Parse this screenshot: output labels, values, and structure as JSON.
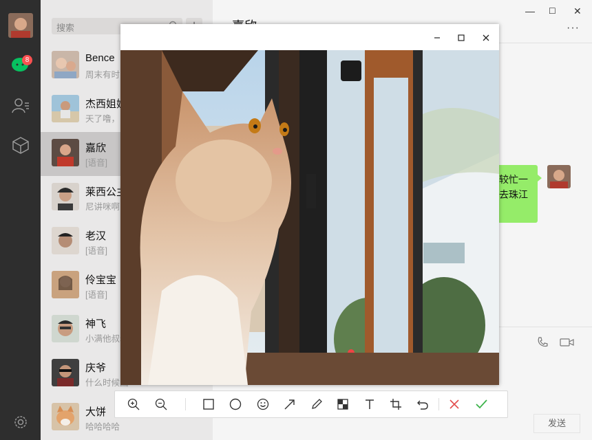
{
  "sidebar": {
    "chat_badge": "8"
  },
  "contacts": {
    "search_placeholder": "搜索",
    "add_label": "+",
    "items": [
      {
        "name": "Bence",
        "msg": "周末有时间吗"
      },
      {
        "name": "杰西姐姐",
        "msg": "天了噜，"
      },
      {
        "name": "嘉欣",
        "msg": "[语音]"
      },
      {
        "name": "莱西公主",
        "msg": "尼讲咪啊"
      },
      {
        "name": "老汉",
        "msg": "[语音]"
      },
      {
        "name": "伶宝宝",
        "msg": "[语音]"
      },
      {
        "name": "神飞",
        "msg": "小满他叔叔"
      },
      {
        "name": "庆爷",
        "msg": "什么时候回"
      },
      {
        "name": "大饼",
        "msg": "哈哈哈哈"
      }
    ]
  },
  "chat": {
    "title": "嘉欣",
    "more": "···",
    "bubble_line1": "较忙一",
    "bubble_line2": "去珠江",
    "send_label": "发送"
  },
  "window": {
    "min": "—",
    "max": "☐",
    "close": "✕"
  }
}
